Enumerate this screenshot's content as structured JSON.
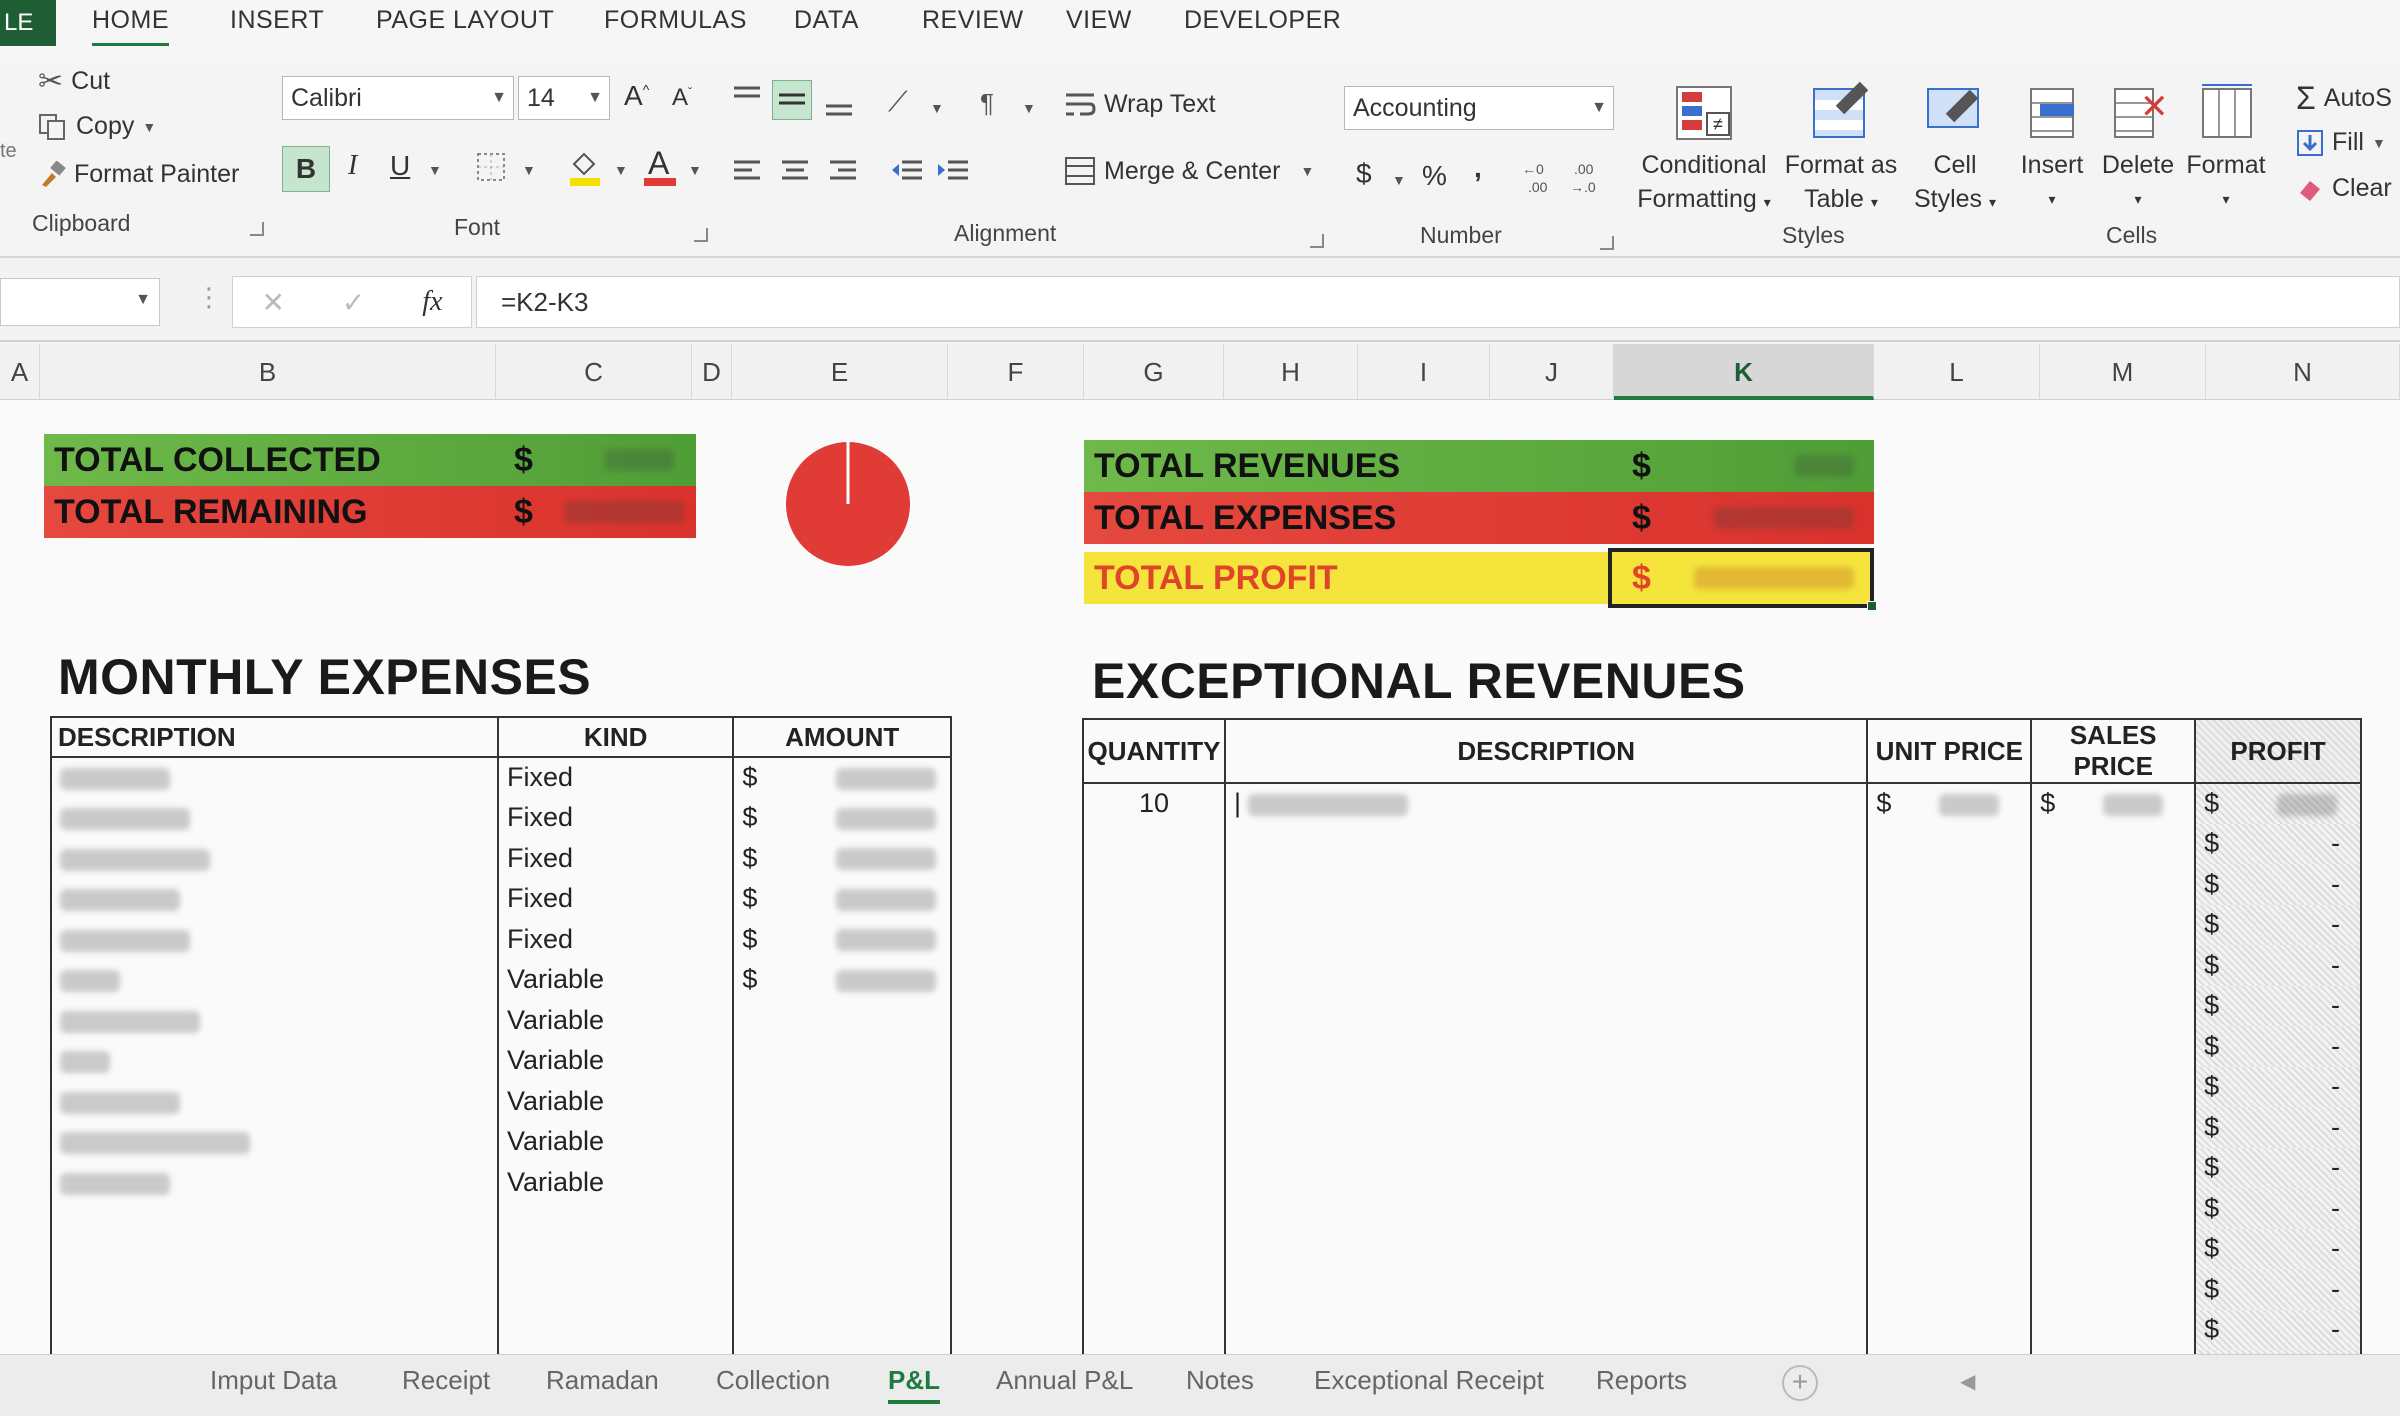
{
  "ribbon_tabs": {
    "file": "LE",
    "home": "HOME",
    "insert": "INSERT",
    "page_layout": "PAGE LAYOUT",
    "formulas": "FORMULAS",
    "data": "DATA",
    "review": "REVIEW",
    "view": "VIEW",
    "developer": "DEVELOPER"
  },
  "clipboard": {
    "paste_partial": "te",
    "cut": "Cut",
    "copy": "Copy",
    "format_painter": "Format Painter",
    "group_label": "Clipboard"
  },
  "font": {
    "name": "Calibri",
    "size": "14",
    "bold": "B",
    "italic": "I",
    "underline": "U",
    "group_label": "Font"
  },
  "alignment": {
    "wrap_text": "Wrap Text",
    "merge_center": "Merge & Center",
    "group_label": "Alignment"
  },
  "number": {
    "format": "Accounting",
    "currency": "$",
    "percent": "%",
    "comma": ",",
    "group_label": "Number"
  },
  "styles": {
    "conditional_line1": "Conditional",
    "conditional_line2": "Formatting",
    "format_table_line1": "Format as",
    "format_table_line2": "Table",
    "cell_styles_line1": "Cell",
    "cell_styles_line2": "Styles",
    "group_label": "Styles"
  },
  "cells": {
    "insert": "Insert",
    "delete": "Delete",
    "format": "Format",
    "group_label": "Cells"
  },
  "editing": {
    "autosum": "AutoS",
    "fill": "Fill",
    "clear": "Clear"
  },
  "formula_bar": {
    "fx": "fx",
    "formula": "=K2-K3"
  },
  "columns": [
    "A",
    "B",
    "C",
    "D",
    "E",
    "F",
    "G",
    "H",
    "I",
    "J",
    "K",
    "L",
    "M",
    "N"
  ],
  "summary_left": {
    "collected_label": "TOTAL COLLECTED",
    "remaining_label": "TOTAL REMAINING",
    "currency": "$"
  },
  "summary_right": {
    "revenues_label": "TOTAL REVENUES",
    "expenses_label": "TOTAL EXPENSES",
    "profit_label": "TOTAL PROFIT",
    "currency": "$"
  },
  "monthly_expenses": {
    "title": "MONTHLY EXPENSES",
    "headers": [
      "DESCRIPTION",
      "KIND",
      "AMOUNT"
    ],
    "rows": [
      {
        "kind": "Fixed",
        "currency": "$"
      },
      {
        "kind": "Fixed",
        "currency": "$"
      },
      {
        "kind": "Fixed",
        "currency": "$"
      },
      {
        "kind": "Fixed",
        "currency": "$"
      },
      {
        "kind": "Fixed",
        "currency": "$"
      },
      {
        "kind": "Variable",
        "currency": "$"
      },
      {
        "kind": "Variable",
        "currency": ""
      },
      {
        "kind": "Variable",
        "currency": ""
      },
      {
        "kind": "Variable",
        "currency": ""
      },
      {
        "kind": "Variable",
        "currency": ""
      },
      {
        "kind": "Variable",
        "currency": ""
      }
    ]
  },
  "exceptional_revenues": {
    "title": "EXCEPTIONAL REVENUES",
    "headers": [
      "QUANTITY",
      "DESCRIPTION",
      "UNIT PRICE",
      "SALES PRICE",
      "PROFIT"
    ],
    "first_row": {
      "quantity": "10",
      "unit_currency": "$",
      "sales_currency": "$",
      "profit_currency": "$"
    },
    "profit_currency": "$",
    "profit_dash": "-"
  },
  "sheet_tabs": [
    "Imput Data",
    "Receipt",
    "Ramadan",
    "Collection",
    "P&L",
    "Annual P&L",
    "Notes",
    "Exceptional Receipt",
    "Reports"
  ],
  "active_sheet": "P&L",
  "colors": {
    "green": "#5fae3e",
    "red": "#e03b36",
    "yellow": "#f4e43c",
    "excel_green": "#1f7a3e"
  }
}
